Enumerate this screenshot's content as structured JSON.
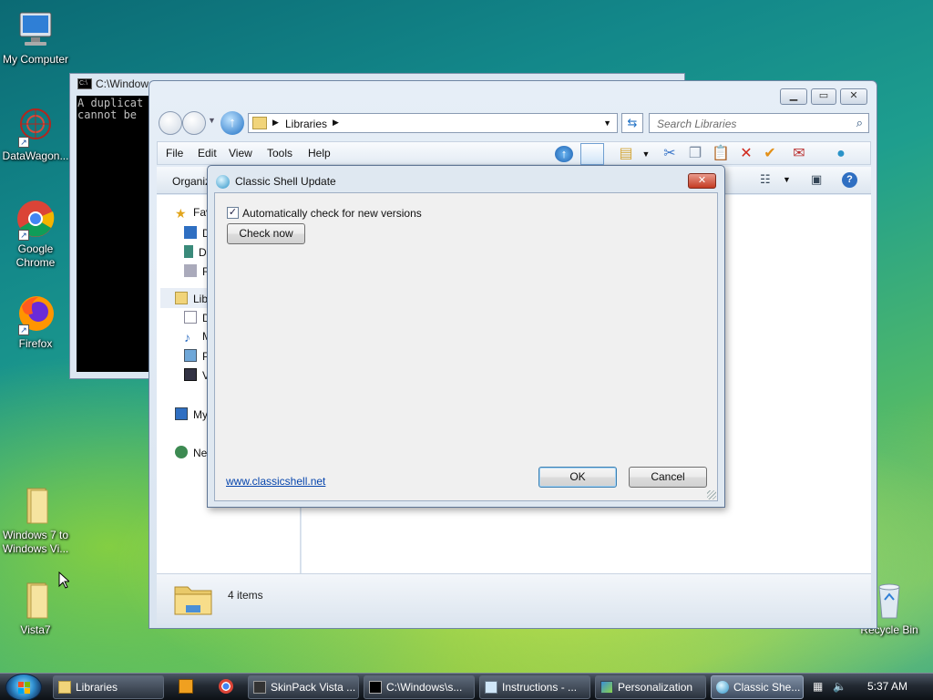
{
  "desktop": {
    "icons": [
      {
        "label": "My Computer"
      },
      {
        "label": "DataWagon..."
      },
      {
        "label": "Google Chrome"
      },
      {
        "label": "Firefox"
      },
      {
        "label": "Windows 7 to Windows Vi..."
      },
      {
        "label": "Vista7"
      },
      {
        "label": "Recycle Bin"
      }
    ]
  },
  "console": {
    "title": "C:\\Window",
    "line1": "A duplicat",
    "line2": "cannot be"
  },
  "explorer": {
    "address": "Libraries",
    "search_placeholder": "Search Libraries",
    "menu": {
      "file": "File",
      "edit": "Edit",
      "view": "View",
      "tools": "Tools",
      "help": "Help"
    },
    "organize": "Organiz",
    "nav": {
      "favorites": "Fav",
      "libraries": "Libr",
      "computer": "My",
      "network": "Ne",
      "sub": [
        "D",
        "D",
        "R",
        "D",
        "M",
        "P",
        "V"
      ]
    },
    "status_count": "4 items"
  },
  "dialog": {
    "title": "Classic Shell Update",
    "close_label": "✕",
    "auto_check_label": "Automatically check for new versions",
    "auto_check_checked": true,
    "check_now_label": "Check now",
    "website_link": "www.classicshell.net",
    "ok_label": "OK",
    "cancel_label": "Cancel"
  },
  "taskbar": {
    "tasks": [
      {
        "label": "Libraries"
      },
      {
        "label": "SkinPack Vista ..."
      },
      {
        "label": "C:\\Windows\\s..."
      },
      {
        "label": "Instructions - ..."
      },
      {
        "label": "Personalization"
      },
      {
        "label": "Classic She..."
      }
    ],
    "clock": "5:37 AM"
  }
}
